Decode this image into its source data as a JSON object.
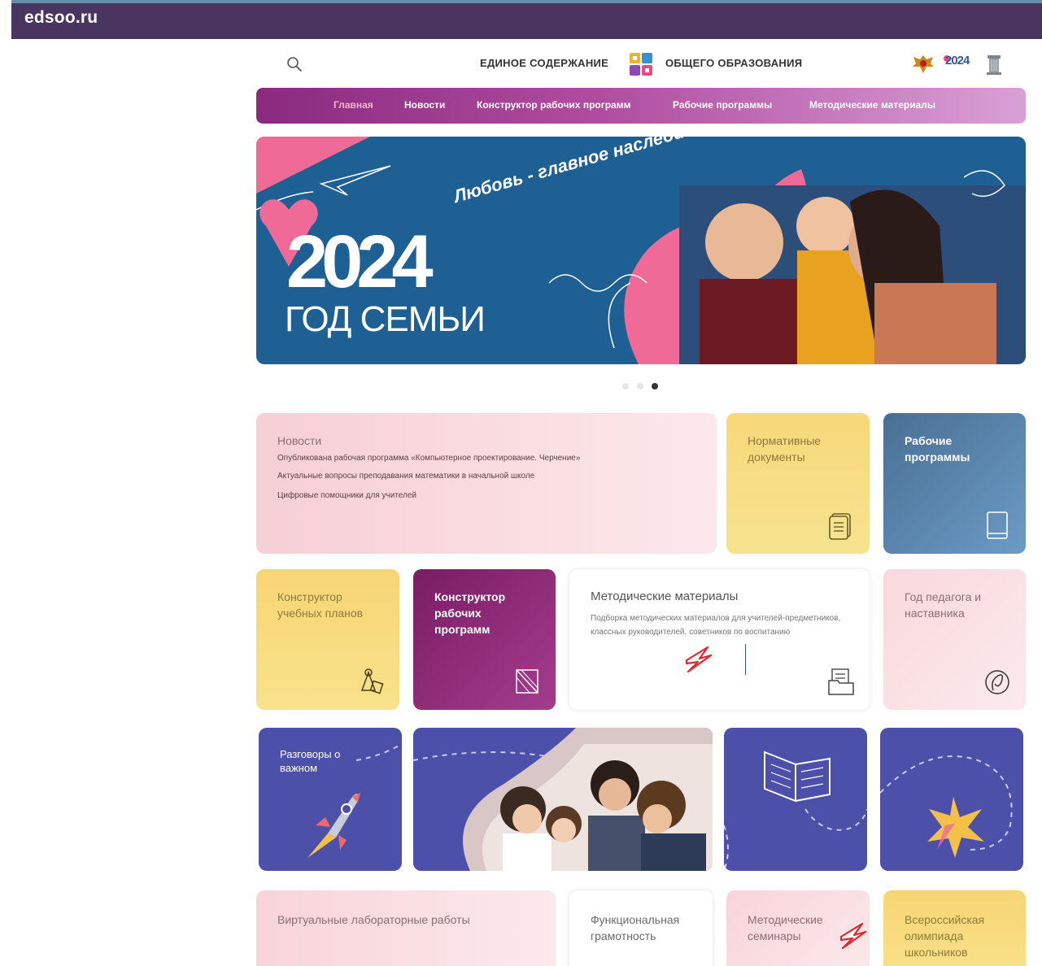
{
  "window": {
    "domain": "edsoo.ru"
  },
  "header": {
    "brand_left": "ЕДИНОЕ СОДЕРЖАНИЕ",
    "brand_right": "ОБЩЕГО ОБРАЗОВАНИЯ",
    "badge_year": "2024"
  },
  "nav": {
    "items": [
      {
        "label": "Главная",
        "active": true
      },
      {
        "label": "Новости"
      },
      {
        "label": "Конструктор рабочих программ"
      },
      {
        "label": "Рабочие программы"
      },
      {
        "label": "Методические материалы"
      }
    ]
  },
  "banner": {
    "slogan": "Любовь - главное наследие",
    "year": "2024",
    "subtitle": "ГОД СЕМЬИ",
    "slides": 3,
    "active_slide": 3
  },
  "tiles": {
    "news": {
      "title": "Новости",
      "items": [
        "Опубликована рабочая программа «Компьютерное проектирование. Черчение»",
        "Актуальные вопросы преподавания математики в начальной школе",
        "Цифровые помощники для учителей"
      ]
    },
    "normative": {
      "title": "Нормативные документы"
    },
    "work_programs": {
      "title": "Рабочие программы"
    },
    "curriculum_builder": {
      "title": "Конструктор учебных планов"
    },
    "program_builder": {
      "title": "Конструктор рабочих программ"
    },
    "methodical": {
      "title": "Методические материалы",
      "description": "Подборка методических материалов для учителей-предметников, классных руководителей, советников по воспитанию"
    },
    "teacher_year": {
      "title": "Год педагога и наставника"
    },
    "talks": {
      "title": "Разговоры о важном"
    },
    "virtual_labs": {
      "title": "Виртуальные лабораторные работы"
    },
    "literacy": {
      "title": "Функциональная грамотность"
    },
    "seminars": {
      "title": "Методические семинары"
    },
    "olympiad": {
      "title": "Всероссийская олимпиада школьников"
    }
  },
  "colors": {
    "titlebar": "#4a3560",
    "nav_start": "#8a2a7e",
    "nav_end": "#d9a0d6",
    "banner_bg": "#1e5f94",
    "accent_pink": "#ef6a96",
    "tile_violet": "#4d50a8",
    "tile_yellow": "#f7d87a"
  }
}
